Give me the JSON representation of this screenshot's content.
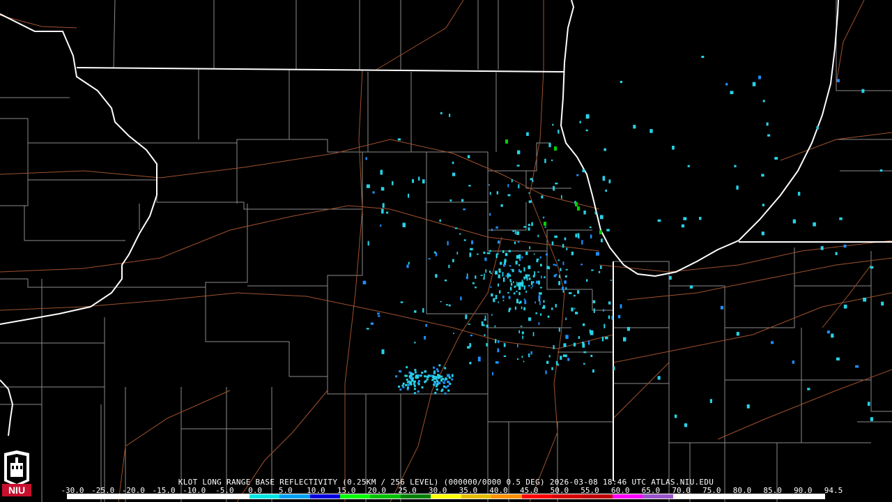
{
  "caption": "KLOT LONG RANGE BASE REFLECTIVITY (0.25KM / 256 LEVEL) (000000/0000 0.5 DEG) 2026-03-08 18:46 UTC  ATLAS.NIU.EDU",
  "logo": {
    "text": "NIU",
    "icon": "niu-logo-icon",
    "color": "#c8102e"
  },
  "scale": {
    "labels": [
      "-30.0",
      "-25.0",
      "-20.0",
      "-15.0",
      "-10.0",
      "-5.0",
      "0.0",
      "5.0",
      "10.0",
      "15.0",
      "20.0",
      "25.0",
      "30.0",
      "35.0",
      "40.0",
      "45.0",
      "50.0",
      "55.0",
      "60.0",
      "65.0",
      "70.0",
      "75.0",
      "80.0",
      "85.0",
      "90.0",
      "94.5"
    ],
    "colors": [
      "#ffffff",
      "#ffffff",
      "#ffffff",
      "#ffffff",
      "#ffffff",
      "#ffffff",
      "#00e5e5",
      "#00a0f0",
      "#0000e0",
      "#00ff00",
      "#00c000",
      "#008000",
      "#ffff00",
      "#e6bc00",
      "#ff9000",
      "#ff0000",
      "#d60000",
      "#c00000",
      "#ff00ff",
      "#9955c9",
      "#ffffff",
      "#ffffff",
      "#ffffff",
      "#ffffff",
      "#ffffff"
    ]
  },
  "colors": {
    "background": "#000000",
    "state_border": "#ffffff",
    "county_border": "#8c8c8c",
    "highway": "#a0522d",
    "echo_light": "#27d3e6",
    "echo_mid": "#1e90ff",
    "echo_strong": "#00d000"
  }
}
